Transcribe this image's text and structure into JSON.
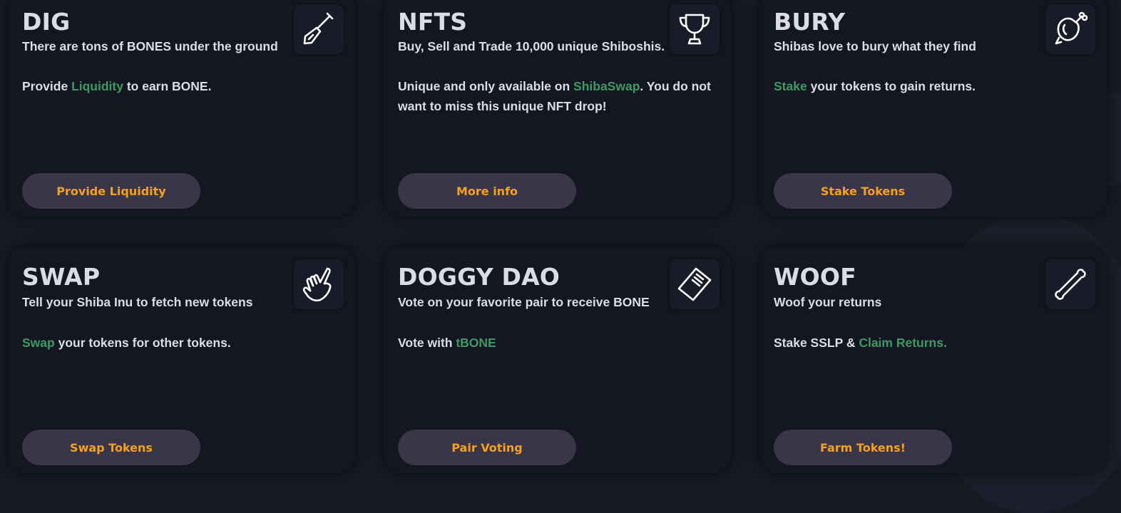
{
  "cards": [
    {
      "title": "DIG",
      "subtitle": "There are tons of BONES under the ground",
      "desc_pre": "Provide ",
      "desc_link": "Liquidity",
      "desc_post": " to earn BONE.",
      "button": "Provide Liquidity",
      "icon": "shovel-icon"
    },
    {
      "title": "NFTS",
      "subtitle": "Buy, Sell and Trade 10,000 unique Shiboshis.",
      "desc_pre": "Unique and only available on ",
      "desc_link": "ShibaSwap",
      "desc_post": ". You do not want to miss this unique NFT drop!",
      "button": "More info",
      "icon": "trophy-icon"
    },
    {
      "title": "BURY",
      "subtitle": "Shibas love to bury what they find",
      "desc_pre": "",
      "desc_link": "Stake",
      "desc_post": " your tokens to gain returns.",
      "button": "Stake Tokens",
      "icon": "meat-bone-icon"
    },
    {
      "title": "SWAP",
      "subtitle": "Tell your Shiba Inu to fetch new tokens",
      "desc_pre": "",
      "desc_link": "Swap",
      "desc_post": " your tokens for other tokens.",
      "button": "Swap Tokens",
      "icon": "pointing-hand-icon"
    },
    {
      "title": "DOGGY DAO",
      "subtitle": "Vote on your favorite pair to receive BONE",
      "desc_pre": "Vote with ",
      "desc_link": "tBONE",
      "desc_post": "",
      "button": "Pair Voting",
      "icon": "ballot-icon"
    },
    {
      "title": "WOOF",
      "subtitle": "Woof your returns",
      "desc_pre": "Stake SSLP & ",
      "desc_link": "Claim Returns.",
      "desc_post": "",
      "button": "Farm Tokens!",
      "icon": "bone-icon"
    }
  ],
  "colors": {
    "background": "#171a25",
    "card": "#141722",
    "text": "#dcdde4",
    "link": "#3e9a62",
    "button_bg": "#3a3649",
    "button_text": "#f5a021"
  }
}
